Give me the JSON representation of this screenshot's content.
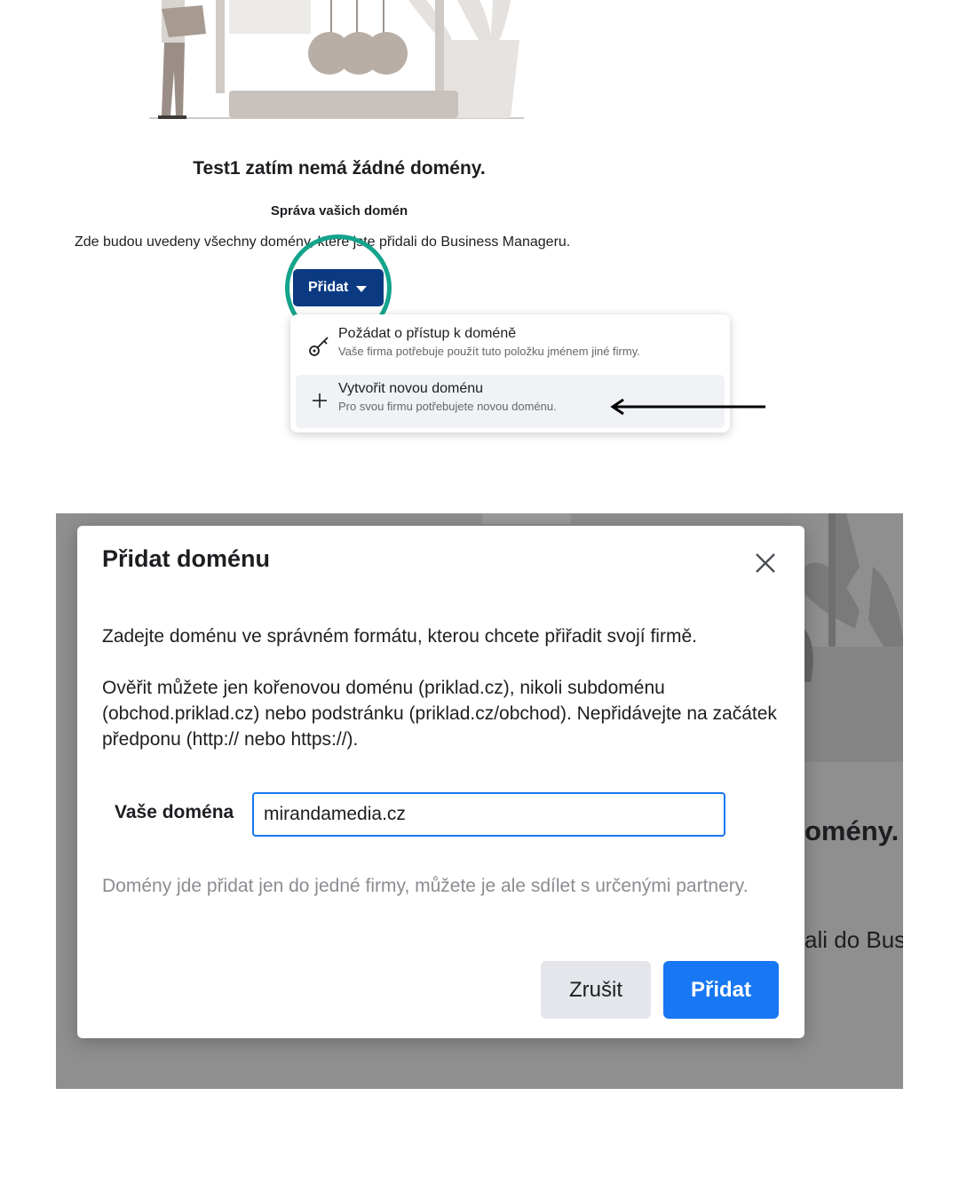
{
  "colors": {
    "primary_dark_blue": "#0b3a82",
    "primary_blue": "#1877f2",
    "highlight_teal": "#14a38b",
    "overlay_gray": "#8f8f8f"
  },
  "empty_state": {
    "title": "Test1 zatím nemá žádné domény.",
    "subtitle": "Správa vašich domén",
    "description": "Zde budou uvedeny všechny domény, které jste přidali do Business Manageru.",
    "add_button_label": "Přidat"
  },
  "dropdown": {
    "items": [
      {
        "icon": "key-icon",
        "label": "Požádat o přístup k doméně",
        "sublabel": "Vaše firma potřebuje použít tuto položku jménem jiné firmy."
      },
      {
        "icon": "plus-icon",
        "label": "Vytvořit novou doménu",
        "sublabel": "Pro svou firmu potřebujete novou doménu."
      }
    ]
  },
  "background": {
    "partial_title": "omény.",
    "partial_text": "ali do Bus"
  },
  "modal": {
    "title": "Přidat doménu",
    "paragraph1": "Zadejte doménu ve správném formátu, kterou chcete přiřadit svojí firmě.",
    "paragraph2": "Ověřit můžete jen kořenovou doménu (priklad.cz), nikoli subdoménu (obchod.priklad.cz) nebo podstránku (priklad.cz/obchod). Nepřidávejte na začátek předponu (http:// nebo https://).",
    "domain_label": "Vaše doména",
    "domain_value": "mirandamedia.cz",
    "note": "Domény jde přidat jen do jedné firmy, můžete je ale sdílet s určenými partnery.",
    "cancel_label": "Zrušit",
    "add_label": "Přidat"
  }
}
